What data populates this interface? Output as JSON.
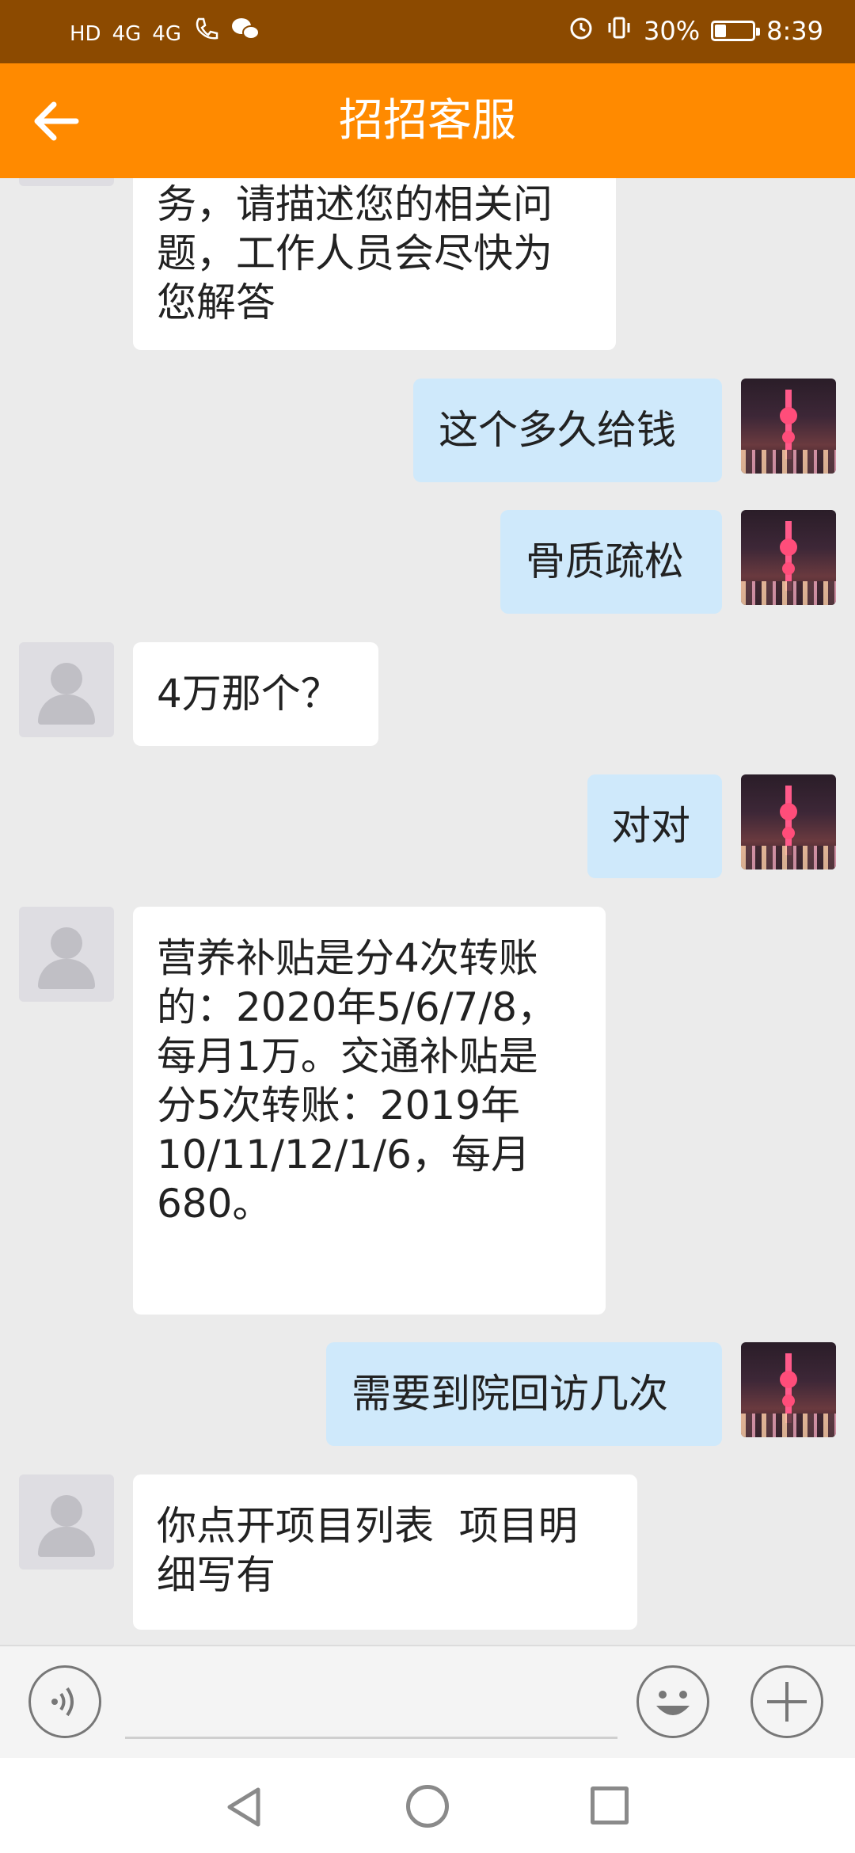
{
  "status_bar": {
    "left_icons": [
      "HD",
      "4G",
      "4G",
      "call-wifi-icon",
      "wechat-icon"
    ],
    "battery_percent": "30%",
    "battery_level": 0.3,
    "time": "8:39"
  },
  "header": {
    "title": "招招客服"
  },
  "messages": [
    {
      "side": "in",
      "text": "务，请描述您的相关问\n题，工作人员会尽快为\n您解答"
    },
    {
      "side": "out",
      "text": "这个多久给钱"
    },
    {
      "side": "out",
      "text": "骨质疏松"
    },
    {
      "side": "in",
      "text": "4万那个？"
    },
    {
      "side": "out",
      "text": "对对"
    },
    {
      "side": "in",
      "text": "营养补贴是分4次转账\n的：2020年5/6/7/8，\n每月1万。交通补贴是\n分5次转账：2019年\n10/11/12/1/6，每月\n680。"
    },
    {
      "side": "out",
      "text": "需要到院回访几次"
    },
    {
      "side": "in",
      "text": "你点开项目列表  项目明\n细写有"
    }
  ],
  "input_bar": {
    "voice_icon": "voice-icon",
    "emoji_icon": "emoji-icon",
    "plus_icon": "plus-icon"
  },
  "nav_bar": {
    "icons": [
      "back-triangle-icon",
      "home-circle-icon",
      "recents-square-icon"
    ]
  }
}
